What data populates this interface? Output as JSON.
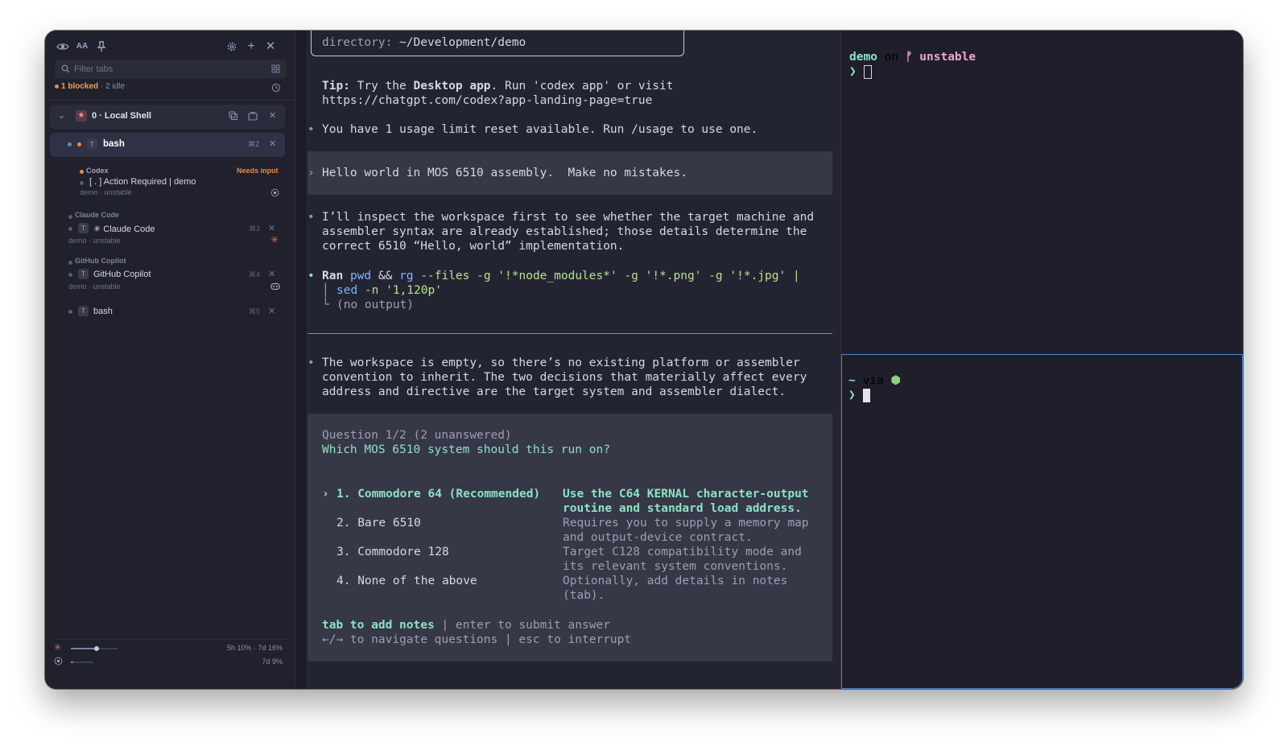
{
  "sidebar": {
    "toolbar_icons": [
      "eye-icon",
      "text-size-icon",
      "pin-icon",
      "gear-icon",
      "plus-icon",
      "close-icon"
    ],
    "toolbar_aa": "AA",
    "filter_placeholder": "Filter tabs",
    "status": {
      "blocked": "1 blocked",
      "separator": "·",
      "idle": "2 idle"
    },
    "group": {
      "title": "0 · Local Shell"
    },
    "items": [
      {
        "label": "bash",
        "shortcut": "⌘2",
        "active": true
      },
      {
        "section": "Codex",
        "label": "[ . ] Action Required | demo",
        "status": "Needs input",
        "meta": "demo · unstable"
      },
      {
        "section": "Claude Code",
        "label": "✳ Claude Code",
        "shortcut": "⌘3",
        "meta": "demo · unstable"
      },
      {
        "section": "GitHub Copilot",
        "label": "GitHub Copilot",
        "shortcut": "⌘4",
        "meta": "demo · unstable"
      },
      {
        "label": "bash",
        "shortcut": "⌘5"
      }
    ],
    "badge_letter": "T",
    "footer": [
      {
        "icon": "claude-usage-icon",
        "text": "5h 10% · 7d 16%",
        "value": 0.55
      },
      {
        "icon": "openai-usage-icon",
        "text": "7d 9%",
        "value": 0.09
      }
    ]
  },
  "center": {
    "directory_label": "directory:",
    "directory_value": "~/Development/demo",
    "tip_label": "Tip:",
    "tip_pre": " Try the ",
    "tip_app": "Desktop app",
    "tip_post": ". Run 'codex app' or visit",
    "tip_url": "https://chatgpt.com/codex?app-landing-page=true",
    "usage_line": "You have 1 usage limit reset available. Run /usage to use one.",
    "user_prompt": "Hello world in MOS 6510 assembly.  Make no mistakes.",
    "inspect_lines": [
      "I’ll inspect the workspace first to see whether the target machine and",
      "assembler syntax are already established; those details determine the",
      "correct 6510 “Hello, world” implementation."
    ],
    "ran": {
      "label": "Ran",
      "cmd1": "pwd",
      "op": "&&",
      "cmd2": "rg",
      "args": " --files -g '!*node_modules*' -g '!*.png' -g '!*.jpg' |",
      "cont_cmd": "sed",
      "cont_args": " -n '1,120p'",
      "output": "(no output)"
    },
    "empty_lines": [
      "The workspace is empty, so there’s no existing platform or assembler",
      "convention to inherit. The two decisions that materially affect every",
      "address and directive are the target system and assembler dialect."
    ],
    "question": {
      "header": "Question 1/2 (2 unanswered)",
      "text": "Which MOS 6510 system should this run on?",
      "options": [
        {
          "label": "1. Commodore 64 (Recommended)",
          "desc": [
            "Use the C64 KERNAL character-output",
            "routine and standard load address."
          ],
          "selected": true
        },
        {
          "label": "2. Bare 6510",
          "desc": [
            "Requires you to supply a memory map",
            "and output-device contract."
          ]
        },
        {
          "label": "3. Commodore 128",
          "desc": [
            "Target C128 compatibility mode and",
            "its relevant system conventions."
          ]
        },
        {
          "label": "4. None of the above",
          "desc": [
            "Optionally, add details in notes",
            "(tab)."
          ]
        }
      ],
      "hint_tab": "tab to add notes",
      "hint_rest": " | enter to submit answer",
      "hint_line2": "←/→ to navigate questions | esc to interrupt"
    }
  },
  "right_top": {
    "dir": "demo",
    "on": " on ",
    "branch_icon": "git-branch-icon",
    "branch": "unstable",
    "prompt_char": "❯"
  },
  "right_bottom": {
    "dir": "~",
    "via": " via ",
    "runtime_icon": "node-hexagon-icon",
    "prompt_char": "❯"
  }
}
